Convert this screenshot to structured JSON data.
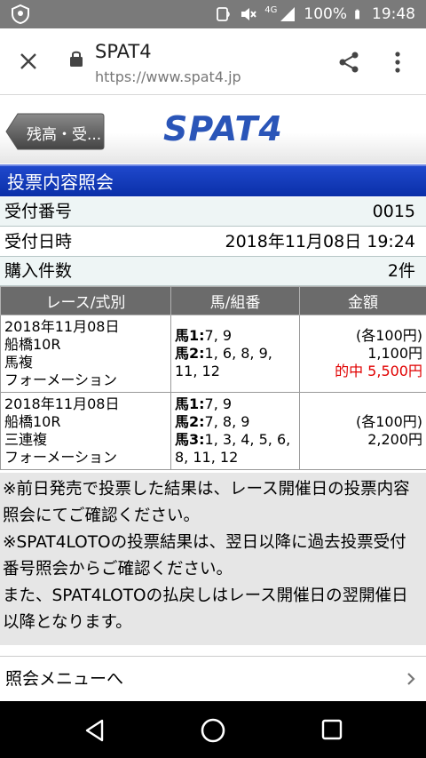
{
  "status_bar": {
    "battery": "100%",
    "time": "19:48",
    "network": "4G"
  },
  "browser": {
    "page_title": "SPAT4",
    "url": "https://www.spat4.jp"
  },
  "header": {
    "back_label": "残高・受...",
    "logo": "SPAT4"
  },
  "section_title": "投票内容照会",
  "info": {
    "receipt_label": "受付番号",
    "receipt_value": "0015",
    "date_label": "受付日時",
    "date_value": "2018年11月08日 19:24",
    "count_label": "購入件数",
    "count_value": "2件"
  },
  "table": {
    "headers": [
      "レース/式別",
      "馬/組番",
      "金額"
    ],
    "rows": [
      {
        "date": "2018年11月08日",
        "race": "船橋10R",
        "bet_type": "馬複",
        "method": "フォーメーション",
        "combos": [
          {
            "label": "馬1:",
            "value": "7, 9"
          },
          {
            "label": "馬2:",
            "value": "1, 6, 8, 9, 11, 12"
          }
        ],
        "unit": "(各100円)",
        "total": "1,100円",
        "hit": "的中  5,500円"
      },
      {
        "date": "2018年11月08日",
        "race": "船橋10R",
        "bet_type": "三連複",
        "method": "フォーメーション",
        "combos": [
          {
            "label": "馬1:",
            "value": "7, 9"
          },
          {
            "label": "馬2:",
            "value": "7, 8, 9"
          },
          {
            "label": "馬3:",
            "value": "1, 3, 4, 5, 6, 8, 11, 12"
          }
        ],
        "unit": "(各100円)",
        "total": "2,200円"
      }
    ]
  },
  "notes": [
    "※前日発売で投票した結果は、レース開催日の投票内容照会にてご確認ください。",
    "※SPAT4LOTOの投票結果は、翌日以降に過去投票受付番号照会からご確認ください。",
    "また、SPAT4LOTOの払戻しはレース開催日の翌開催日以降となります。"
  ],
  "menu_link": "照会メニューへ",
  "colors": {
    "section_blue": "#0a2fa8",
    "logo_blue": "#2a55b8",
    "hit_red": "#e00000",
    "table_header_gray": "#6b6b6b"
  }
}
